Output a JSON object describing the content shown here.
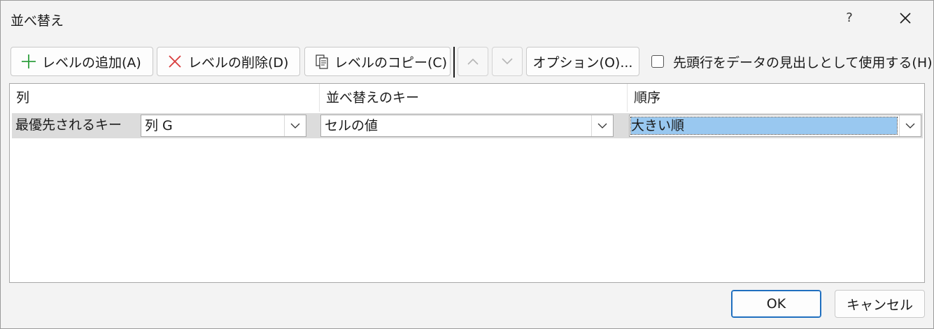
{
  "dialog": {
    "title": "並べ替え",
    "help_label": "?"
  },
  "toolbar": {
    "add_level": "レベルの追加(A)",
    "delete_level": "レベルの削除(D)",
    "copy_level": "レベルのコピー(C)",
    "options": "オプション(O)...",
    "header_checkbox_label": "先頭行をデータの見出しとして使用する(H)",
    "header_checkbox_checked": false
  },
  "grid": {
    "headers": {
      "column": "列",
      "sort_on": "並べ替えのキー",
      "order": "順序"
    },
    "rows": [
      {
        "label": "最優先されるキー",
        "column_value": "列 G",
        "sort_on_value": "セルの値",
        "order_value": "大きい順"
      }
    ]
  },
  "footer": {
    "ok_label": "OK",
    "cancel_label": "キャンセル"
  },
  "colors": {
    "accent": "#1f6fbf",
    "selection": "#99c8f0",
    "add_icon": "#2e9e3e",
    "delete_icon": "#d83b3b"
  }
}
